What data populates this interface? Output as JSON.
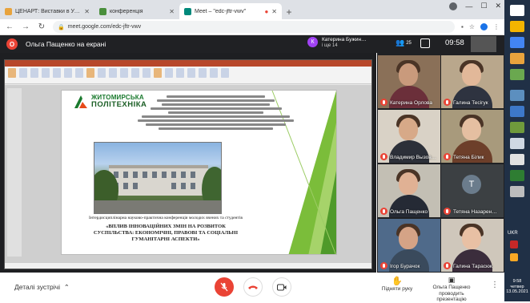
{
  "browser": {
    "tabs": [
      {
        "label": "ЦЕНАРТ: Виставки в Україні, ю…",
        "color": "#e8a33d",
        "active": false
      },
      {
        "label": "конференція",
        "color": "#4a8f3c",
        "active": false
      },
      {
        "label": "Meet – \"edc-jftr-vwv\"",
        "color": "#00897b",
        "active": true
      }
    ],
    "new_tab": "+",
    "url": "meet.google.com/edc-jftr-vwv"
  },
  "meet": {
    "presenting_label": "Ольга Пащенко на екрані",
    "presenting_initial": "О",
    "top_participant": {
      "initial": "К",
      "name": "Катерина Бужин…",
      "sub": "і ще 14"
    },
    "participant_count": "25",
    "time": "09:58",
    "slide": {
      "logo_line1": "ЖИТОМИРСЬКА",
      "logo_line2": "ПОЛІТЕХНІКА",
      "subtitle": "Інтердисциплінарна науково-практична конференція молодих вчених та студентів",
      "title": "«ВПЛИВ ІННОВАЦІЙНИХ ЗМІН НА РОЗВИТОК СУСПІЛЬСТВА: ЕКОНОМІЧНІ, ПРАВОВІ ТА СОЦІАЛЬНІ ГУМАНІТАРНІ АСПЕКТИ»"
    },
    "participants": [
      {
        "name": "Катерина Орлова",
        "kind": "video",
        "bg": "#8a7058",
        "skin": "#c99a7c",
        "cloth": "#6b2f3a"
      },
      {
        "name": "Галина Тесігук",
        "kind": "video",
        "bg": "#b9a78c",
        "skin": "#e2b899",
        "cloth": "#2e3340"
      },
      {
        "name": "Владимир Вызов…",
        "kind": "video",
        "bg": "#d9d2c6",
        "skin": "#d7a988",
        "cloth": "#2c3039"
      },
      {
        "name": "Тетяна Білик",
        "kind": "video",
        "bg": "#a89a7c",
        "skin": "#e5bfa1",
        "cloth": "#6d3f2a"
      },
      {
        "name": "Ольга Пащенко",
        "kind": "video",
        "bg": "#c3bfb4",
        "skin": "#e0b194",
        "cloth": "#252a35"
      },
      {
        "name": "Тетяна Назарен…",
        "kind": "avatar",
        "initial": "Т"
      },
      {
        "name": "Ігор Бурачок",
        "kind": "video",
        "bg": "#4f6a8a",
        "skin": "#d5a386",
        "cloth": "#3a4a5c"
      },
      {
        "name": "Галина Тарасюк",
        "kind": "video",
        "bg": "#cfc7bb",
        "skin": "#e8c0a4",
        "cloth": "#3b2d3c"
      }
    ],
    "bottom": {
      "details": "Деталі зустрічі",
      "raise_hand": "Підняти руку",
      "presenter_line1": "Ольга Пащенко",
      "presenter_line2": "проводить презентацію"
    }
  },
  "taskbar": {
    "lang": "UKR",
    "time": "9:58",
    "date_line": "четвер",
    "date": "13.05.2021"
  }
}
